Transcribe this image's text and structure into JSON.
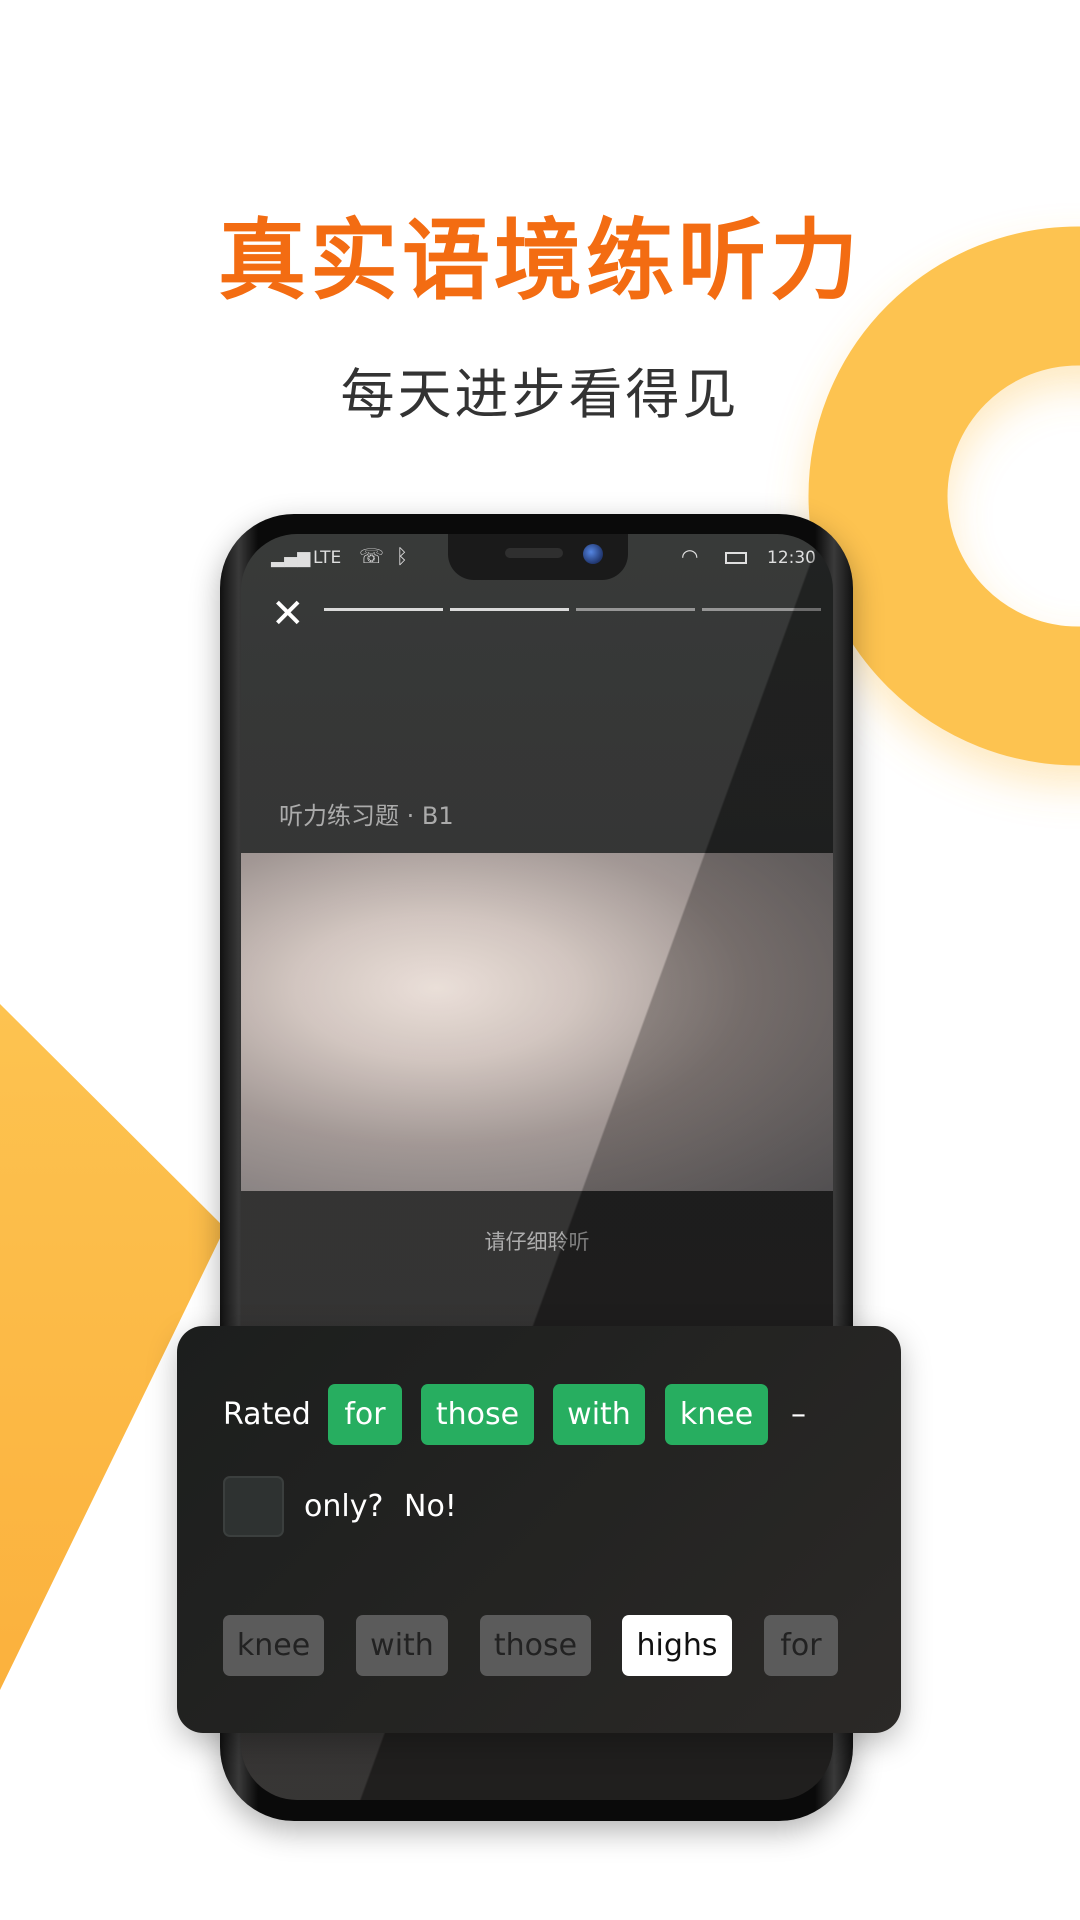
{
  "headline": "真实语境练听力",
  "subheadline": "每天进步看得见",
  "colors": {
    "accent": "#f36c12",
    "ring": "#fdc350",
    "correct": "#27ae60"
  },
  "status_bar": {
    "network": "LTE",
    "time": "12:30",
    "icons": [
      "signal-icon",
      "call-forward-icon",
      "bluetooth-icon",
      "wifi-icon",
      "battery-icon"
    ]
  },
  "app": {
    "close_icon": "✕",
    "progress_segments": [
      true,
      true,
      false,
      false
    ],
    "exercise_label": "听力练习题 · B1",
    "hint": "请仔细聆听"
  },
  "quiz": {
    "sentence_start": "Rated",
    "filled_words": [
      "for",
      "those",
      "with",
      "knee"
    ],
    "dash": "–",
    "sentence_end": "only?",
    "exclaim": "No!",
    "options": [
      {
        "label": "knee",
        "state": "used"
      },
      {
        "label": "with",
        "state": "used"
      },
      {
        "label": "those",
        "state": "used"
      },
      {
        "label": "highs",
        "state": "available"
      },
      {
        "label": "for",
        "state": "used"
      }
    ]
  }
}
